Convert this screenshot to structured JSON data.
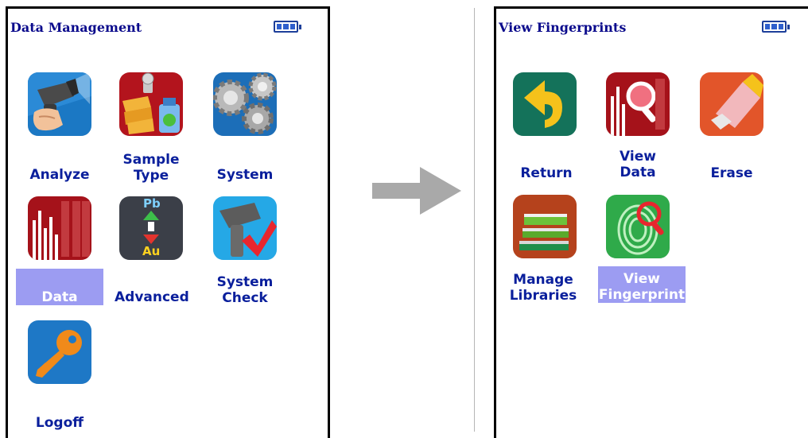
{
  "left_screen": {
    "title": "Data Management",
    "items": [
      {
        "label": "Analyze",
        "icon": "xrf-analyzer-icon",
        "selected": false
      },
      {
        "label": "Sample Type",
        "icon": "sample-type-icon",
        "selected": false
      },
      {
        "label": "System",
        "icon": "gears-icon",
        "selected": false
      },
      {
        "label": "Data",
        "icon": "data-chart-icon",
        "selected": true
      },
      {
        "label": "Advanced",
        "icon": "pb-au-icon",
        "selected": false
      },
      {
        "label": "System Check",
        "icon": "system-check-icon",
        "selected": false
      },
      {
        "label": "Logoff",
        "icon": "key-icon",
        "selected": false
      }
    ]
  },
  "right_screen": {
    "title": "View Fingerprints",
    "items": [
      {
        "label": "Return",
        "icon": "return-arrow-icon",
        "selected": false
      },
      {
        "label": "View Data",
        "icon": "view-data-icon",
        "selected": false
      },
      {
        "label": "Erase",
        "icon": "eraser-icon",
        "selected": false
      },
      {
        "label": "Manage Libraries",
        "icon": "books-icon",
        "selected": false
      },
      {
        "label": "View Fingerprint",
        "icon": "fingerprint-icon",
        "selected": true
      }
    ]
  },
  "icon_text": {
    "pb": "Pb",
    "au": "Au"
  },
  "colors": {
    "title": "#0a0a8c",
    "label": "#0a1f9c",
    "selected_bg": "#9c9cf2",
    "arrow": "#a9a9a9"
  }
}
